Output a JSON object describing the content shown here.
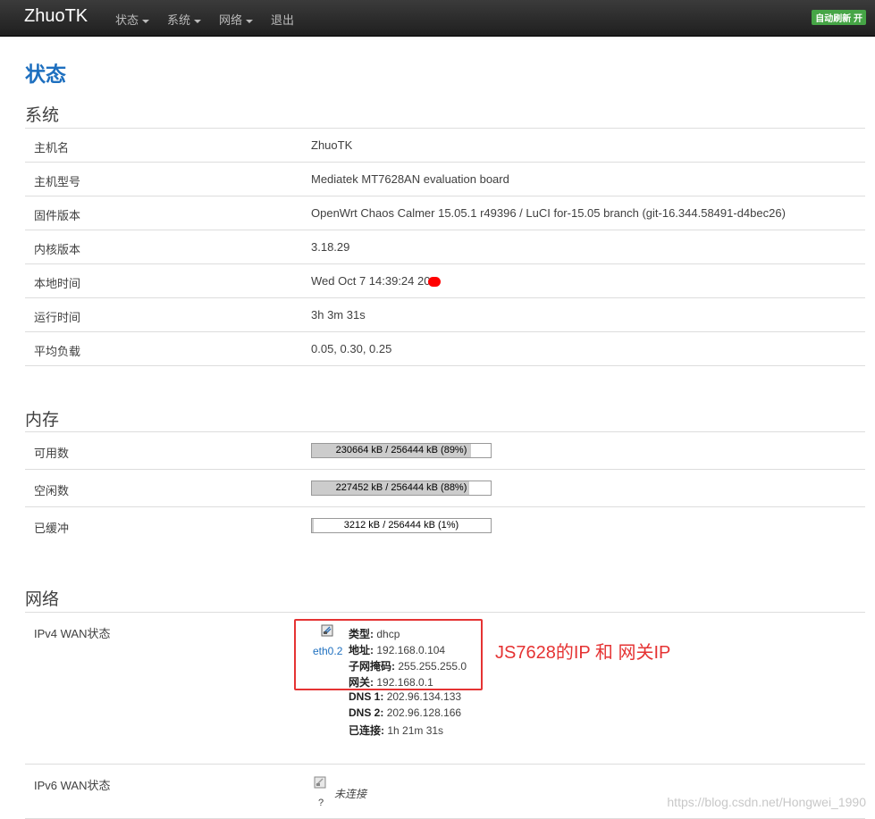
{
  "navbar": {
    "brand": "ZhuoTK",
    "menu": [
      "状态",
      "系统",
      "网络",
      "退出"
    ],
    "autorefresh": "自动刷新 开"
  },
  "page_title": "状态",
  "system": {
    "title": "系统",
    "rows": [
      {
        "label": "主机名",
        "value": "ZhuoTK"
      },
      {
        "label": "主机型号",
        "value": "Mediatek MT7628AN evaluation board"
      },
      {
        "label": "固件版本",
        "value": "OpenWrt Chaos Calmer 15.05.1 r49396 / LuCI for-15.05 branch (git-16.344.58491-d4bec26)"
      },
      {
        "label": "内核版本",
        "value": "3.18.29"
      },
      {
        "label": "本地时间",
        "value": "Wed Oct 7 14:39:24 20"
      },
      {
        "label": "运行时间",
        "value": "3h 3m 31s"
      },
      {
        "label": "平均负载",
        "value": "0.05, 0.30, 0.25"
      }
    ]
  },
  "memory": {
    "title": "内存",
    "rows": [
      {
        "label": "可用数",
        "text": "230664 kB / 256444 kB (89%)",
        "percent": 89
      },
      {
        "label": "空闲数",
        "text": "227452 kB / 256444 kB (88%)",
        "percent": 88
      },
      {
        "label": "已缓冲",
        "text": "3212 kB / 256444 kB (1%)",
        "percent": 1
      }
    ]
  },
  "network": {
    "title": "网络",
    "ipv4_label": "IPv4 WAN状态",
    "iface": "eth0.2",
    "details": [
      {
        "key": "类型:",
        "value": "dhcp"
      },
      {
        "key": "地址:",
        "value": "192.168.0.104"
      },
      {
        "key": "子网掩码:",
        "value": "255.255.255.0"
      },
      {
        "key": "网关:",
        "value": "192.168.0.1"
      },
      {
        "key": "DNS 1:",
        "value": "202.96.134.133"
      },
      {
        "key": "DNS 2:",
        "value": "202.96.128.166"
      },
      {
        "key": "已连接:",
        "value": "1h 21m 31s"
      }
    ],
    "ipv6_label": "IPv6 WAN状态",
    "ipv6_status": "未连接",
    "ipv6_icon_text": "?"
  },
  "annotation": "JS7628的IP 和 网关IP",
  "watermark": "https://blog.csdn.net/Hongwei_1990",
  "colors": {
    "title_blue": "#1d6fbf",
    "annotation_red": "#e53333",
    "refresh_green": "#46a546"
  }
}
